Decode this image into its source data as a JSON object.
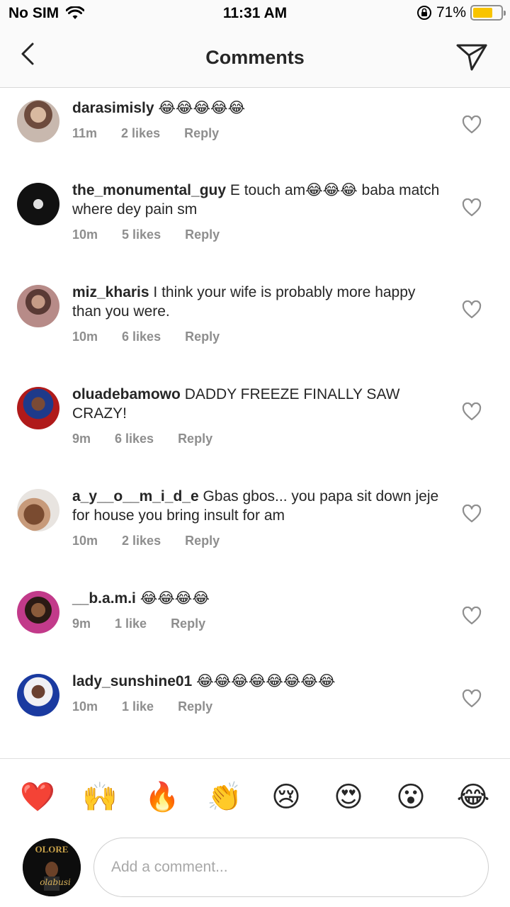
{
  "status_bar": {
    "carrier": "No SIM",
    "time": "11:31 AM",
    "battery_percent": "71%",
    "battery_level": 0.71
  },
  "header": {
    "title": "Comments"
  },
  "comments": [
    {
      "user": "darasimisly",
      "text": " 😂😂😂😂😂",
      "time": "11m",
      "likes": "2 likes",
      "reply": "Reply"
    },
    {
      "user": "the_monumental_guy",
      "text": " E touch am😂😂😂 baba match where dey pain sm",
      "time": "10m",
      "likes": "5 likes",
      "reply": "Reply"
    },
    {
      "user": "miz_kharis",
      "text": " I think your wife is probably more happy than you were.",
      "time": "10m",
      "likes": "6 likes",
      "reply": "Reply"
    },
    {
      "user": "oluadebamowo",
      "text": " DADDY FREEZE FINALLY SAW CRAZY!",
      "time": "9m",
      "likes": "6 likes",
      "reply": "Reply"
    },
    {
      "user": "a_y__o__m_i_d_e",
      "text": " Gbas gbos... you papa sit down jeje for house you bring insult for am",
      "time": "10m",
      "likes": "2 likes",
      "reply": "Reply"
    },
    {
      "user": "__b.a.m.i",
      "text": " 😂😂😂😂",
      "time": "9m",
      "likes": "1 like",
      "reply": "Reply"
    },
    {
      "user": "lady_sunshine01",
      "text": " 😂😂😂😂😂😂😂😂",
      "time": "10m",
      "likes": "1 like",
      "reply": "Reply"
    }
  ],
  "emoji_bar": [
    "❤️",
    "🙌",
    "🔥",
    "👏",
    "😢",
    "😍",
    "😮",
    "😂"
  ],
  "input": {
    "placeholder": "Add a comment..."
  },
  "icons": {
    "back": "chevron-left-icon",
    "send": "paper-plane-icon",
    "like": "heart-outline-icon",
    "wifi": "wifi-icon",
    "orientation_lock": "orientation-lock-icon",
    "battery": "battery-icon"
  },
  "colors": {
    "battery_fill": "#f8c400",
    "meta_text": "#8e8e8e",
    "text": "#262626"
  },
  "me_avatar_text": [
    "OLORE",
    "olabusi"
  ]
}
